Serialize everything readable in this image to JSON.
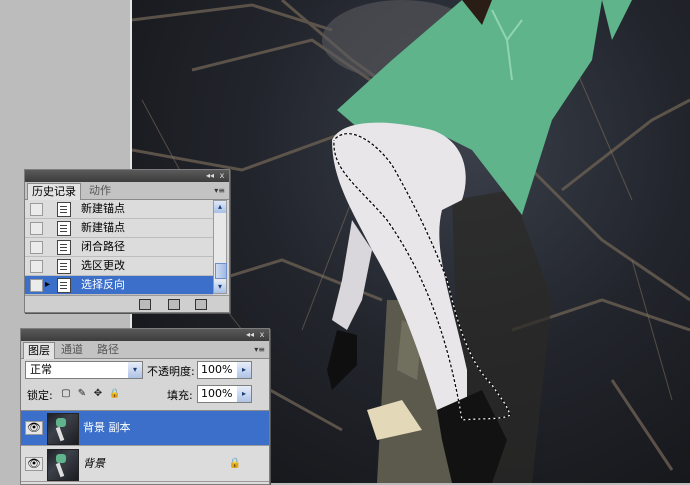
{
  "history_panel": {
    "tabs": [
      "历史记录",
      "动作"
    ],
    "active_tab": "历史记录",
    "items": [
      {
        "label": "新建锚点",
        "selected": false
      },
      {
        "label": "新建锚点",
        "selected": false
      },
      {
        "label": "闭合路径",
        "selected": false
      },
      {
        "label": "选区更改",
        "selected": false
      },
      {
        "label": "选择反向",
        "selected": true
      }
    ],
    "collapse_glyph": "◂◂",
    "close_glyph": "x",
    "menu_glyph": "▾≡",
    "footer_icons": [
      "new-snapshot-icon",
      "new-document-icon",
      "trash-icon"
    ]
  },
  "layers_panel": {
    "tabs": [
      "图层",
      "通道",
      "路径"
    ],
    "active_tab": "图层",
    "blend_mode": "正常",
    "opacity_label": "不透明度:",
    "opacity_value": "100%",
    "lock_label": "锁定:",
    "fill_label": "填充:",
    "fill_value": "100%",
    "layers": [
      {
        "name": "背景 副本",
        "selected": true,
        "locked": false,
        "italic": false
      },
      {
        "name": "背景",
        "selected": false,
        "locked": true,
        "italic": true
      }
    ]
  },
  "glyphs": {
    "dropdown": "▾",
    "go": "▸",
    "scroll_up": "▴",
    "scroll_down": "▾",
    "history_state": "▸",
    "lock_transparent": "▢",
    "lock_paint": "✎",
    "lock_move": "✥",
    "lock_all": "🔒",
    "eye": "👁",
    "lock_badge": "🔒"
  },
  "colors": {
    "selection": "#3b6fc9",
    "dress": "#5fb48c",
    "panel_bg": "#d6d6d6"
  }
}
